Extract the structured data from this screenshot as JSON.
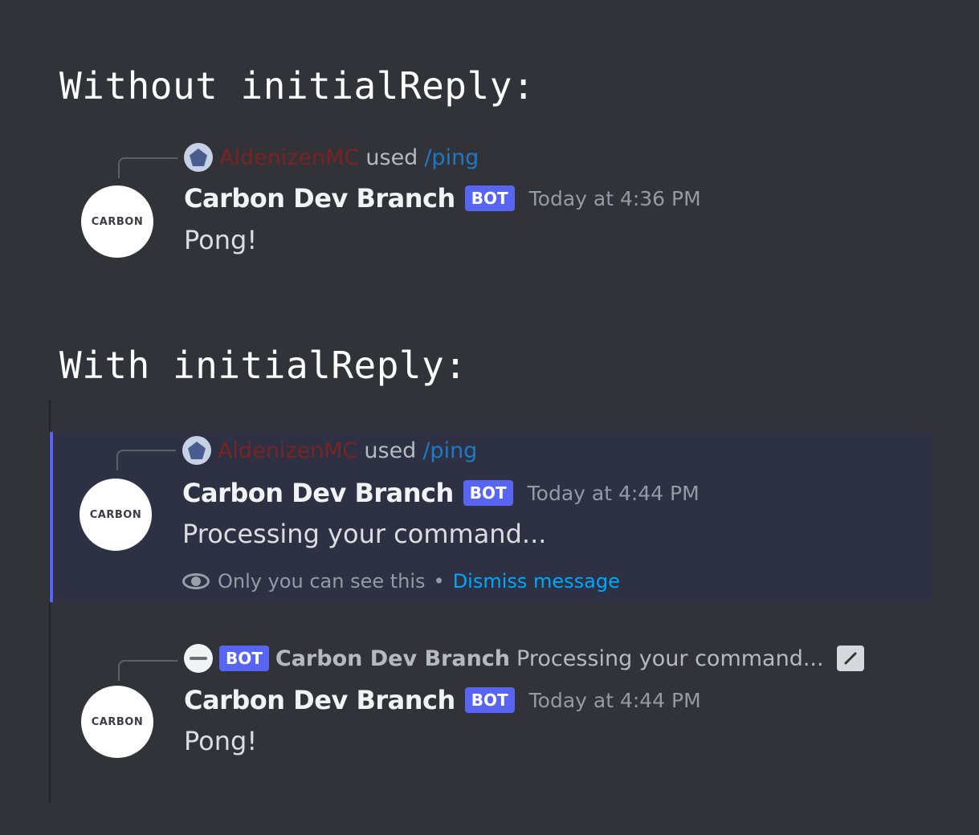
{
  "headings": {
    "without": "Without initialReply:",
    "with": "With initialReply:"
  },
  "messages": [
    {
      "reply": {
        "user": "AldenizenMC",
        "used": "used",
        "command": "/ping"
      },
      "author": "Carbon Dev Branch",
      "badge": "BOT",
      "time": "Today at 4:36 PM",
      "content": "Pong!",
      "avatar_text": "CARBON"
    },
    {
      "reply": {
        "user": "AldenizenMC",
        "used": "used",
        "command": "/ping"
      },
      "author": "Carbon Dev Branch",
      "badge": "BOT",
      "time": "Today at 4:44 PM",
      "content": "Processing your command...",
      "avatar_text": "CARBON",
      "ephemeral": {
        "notice": "Only you can see this",
        "separator": "•",
        "dismiss": "Dismiss message"
      }
    },
    {
      "reply": {
        "badge": "BOT",
        "name": "Carbon Dev Branch",
        "text": "Processing your command..."
      },
      "author": "Carbon Dev Branch",
      "badge": "BOT",
      "time": "Today at 4:44 PM",
      "content": "Pong!",
      "avatar_text": "CARBON"
    }
  ],
  "colors": {
    "background": "#313338",
    "highlight": "#2e3143",
    "accent": "#5865f2",
    "link": "#00a8fc",
    "command": "#1e79c6",
    "username": "#7a2323"
  },
  "icons": [
    "user-avatar-icon",
    "bot-avatar-icon",
    "eye-icon",
    "edit-icon"
  ]
}
